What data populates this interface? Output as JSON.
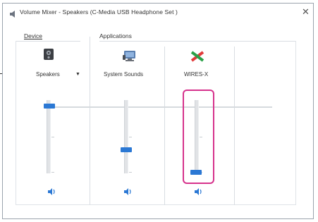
{
  "window": {
    "title": "Volume Mixer - Speakers (C-Media USB Headphone Set )"
  },
  "sections": {
    "device_label": "Device",
    "applications_label": "Applications"
  },
  "channels": [
    {
      "label": "Speakers",
      "has_dropdown": true,
      "icon": "speaker-device-icon",
      "level": 0.95
    },
    {
      "label": "System Sounds",
      "has_dropdown": false,
      "icon": "system-sounds-icon",
      "level": 0.35
    },
    {
      "label": "WIRES-X",
      "has_dropdown": false,
      "icon": "wires-x-icon",
      "level": 0.02
    }
  ],
  "colors": {
    "accent": "#2b78d4",
    "highlight": "#d6328c"
  }
}
